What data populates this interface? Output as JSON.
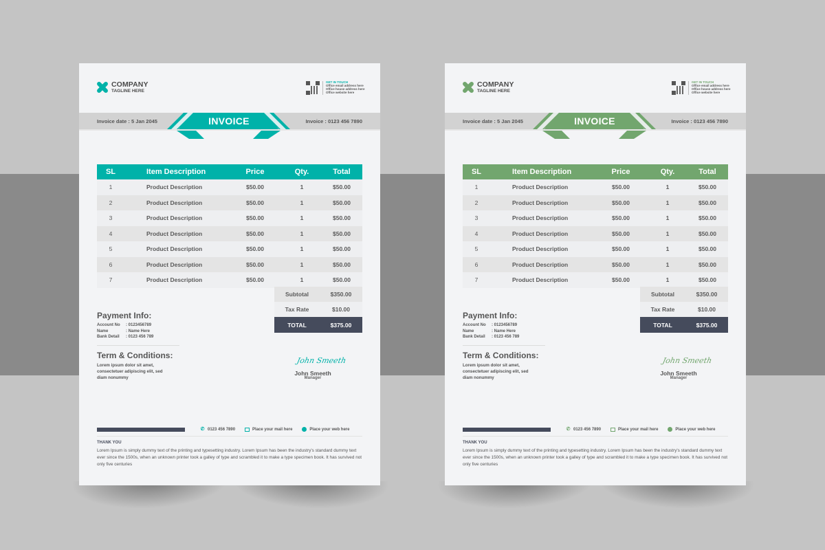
{
  "background": {
    "light_gray": "#c4c4c4",
    "band_gray": "#8a8a8a"
  },
  "invoices": [
    {
      "variant": "teal",
      "accent": "#00b2a9",
      "company": {
        "name": "COMPANY",
        "tagline": "TAGLINE HERE"
      },
      "contact": {
        "title": "GET IN TOUCH",
        "lines": [
          "Office email address here",
          "Office house address here",
          "Office website here"
        ]
      },
      "title": "INVOICE",
      "invoice_date": "Invoice date : 5 Jan 2045",
      "invoice_number": "Invoice : 0123 456 7890",
      "table": {
        "headers": [
          "SL",
          "Item Description",
          "Price",
          "Qty.",
          "Total"
        ],
        "rows": [
          [
            "1",
            "Product Description",
            "$50.00",
            "1",
            "$50.00"
          ],
          [
            "2",
            "Product Description",
            "$50.00",
            "1",
            "$50.00"
          ],
          [
            "3",
            "Product Description",
            "$50.00",
            "1",
            "$50.00"
          ],
          [
            "4",
            "Product Description",
            "$50.00",
            "1",
            "$50.00"
          ],
          [
            "5",
            "Product Description",
            "$50.00",
            "1",
            "$50.00"
          ],
          [
            "6",
            "Product Description",
            "$50.00",
            "1",
            "$50.00"
          ],
          [
            "7",
            "Product Description",
            "$50.00",
            "1",
            "$50.00"
          ]
        ]
      },
      "summary": {
        "subtotal_label": "Subtotal",
        "subtotal": "$350.00",
        "tax_label": "Tax Rate",
        "tax": "$10.00",
        "total_label": "TOTAL",
        "total": "$375.00"
      },
      "payment": {
        "title": "Payment Info:",
        "rows": [
          {
            "key": "Account No",
            "value": ": 0123456789"
          },
          {
            "key": "Name",
            "value": ": Name Here"
          },
          {
            "key": "Bank Detail",
            "value": ": 0123 456 789"
          }
        ]
      },
      "terms": {
        "title": "Term & Conditions:",
        "text": "Lorem ipsum dolor sit amet, consectetuer adipiscing elit, sed diam nonummy"
      },
      "signature": {
        "script": "John Smeeth",
        "name": "John Smeeth",
        "role": "Manager"
      },
      "footer": {
        "phone": "0123 456 7890",
        "mail": "Place your mail here",
        "web": "Place your web here",
        "thanks_title": "THANK YOU",
        "thanks_text": "Lorem Ipsum is simply dummy text of the printing and typesetting industry. Lorem Ipsum has been the industry's standard dummy text ever since the 1500s, when an unknown printer took a galley of type and scrambled it to make a type specimen book. It has survived not only five centuries"
      }
    },
    {
      "variant": "green",
      "accent": "#72a66e",
      "company": {
        "name": "COMPANY",
        "tagline": "TAGLINE HERE"
      },
      "contact": {
        "title": "GET IN TOUCH",
        "lines": [
          "Office email address here",
          "Office house address here",
          "Office website here"
        ]
      },
      "title": "INVOICE",
      "invoice_date": "Invoice date : 5 Jan 2045",
      "invoice_number": "Invoice : 0123 456 7890",
      "table": {
        "headers": [
          "SL",
          "Item Description",
          "Price",
          "Qty.",
          "Total"
        ],
        "rows": [
          [
            "1",
            "Product Description",
            "$50.00",
            "1",
            "$50.00"
          ],
          [
            "2",
            "Product Description",
            "$50.00",
            "1",
            "$50.00"
          ],
          [
            "3",
            "Product Description",
            "$50.00",
            "1",
            "$50.00"
          ],
          [
            "4",
            "Product Description",
            "$50.00",
            "1",
            "$50.00"
          ],
          [
            "5",
            "Product Description",
            "$50.00",
            "1",
            "$50.00"
          ],
          [
            "6",
            "Product Description",
            "$50.00",
            "1",
            "$50.00"
          ],
          [
            "7",
            "Product Description",
            "$50.00",
            "1",
            "$50.00"
          ]
        ]
      },
      "summary": {
        "subtotal_label": "Subtotal",
        "subtotal": "$350.00",
        "tax_label": "Tax Rate",
        "tax": "$10.00",
        "total_label": "TOTAL",
        "total": "$375.00"
      },
      "payment": {
        "title": "Payment Info:",
        "rows": [
          {
            "key": "Account No",
            "value": ": 0123456789"
          },
          {
            "key": "Name",
            "value": ": Name Here"
          },
          {
            "key": "Bank Detail",
            "value": ": 0123 456 789"
          }
        ]
      },
      "terms": {
        "title": "Term & Conditions:",
        "text": "Lorem ipsum dolor sit amet, consectetuer adipiscing elit, sed diam nonummy"
      },
      "signature": {
        "script": "John Smeeth",
        "name": "John Smeeth",
        "role": "Manager"
      },
      "footer": {
        "phone": "0123 456 7890",
        "mail": "Place your mail here",
        "web": "Place your web here",
        "thanks_title": "THANK YOU",
        "thanks_text": "Lorem Ipsum is simply dummy text of the printing and typesetting industry. Lorem Ipsum has been the industry's standard dummy text ever since the 1500s, when an unknown printer took a galley of type and scrambled it to make a type specimen book. It has survived not only five centuries"
      }
    }
  ]
}
